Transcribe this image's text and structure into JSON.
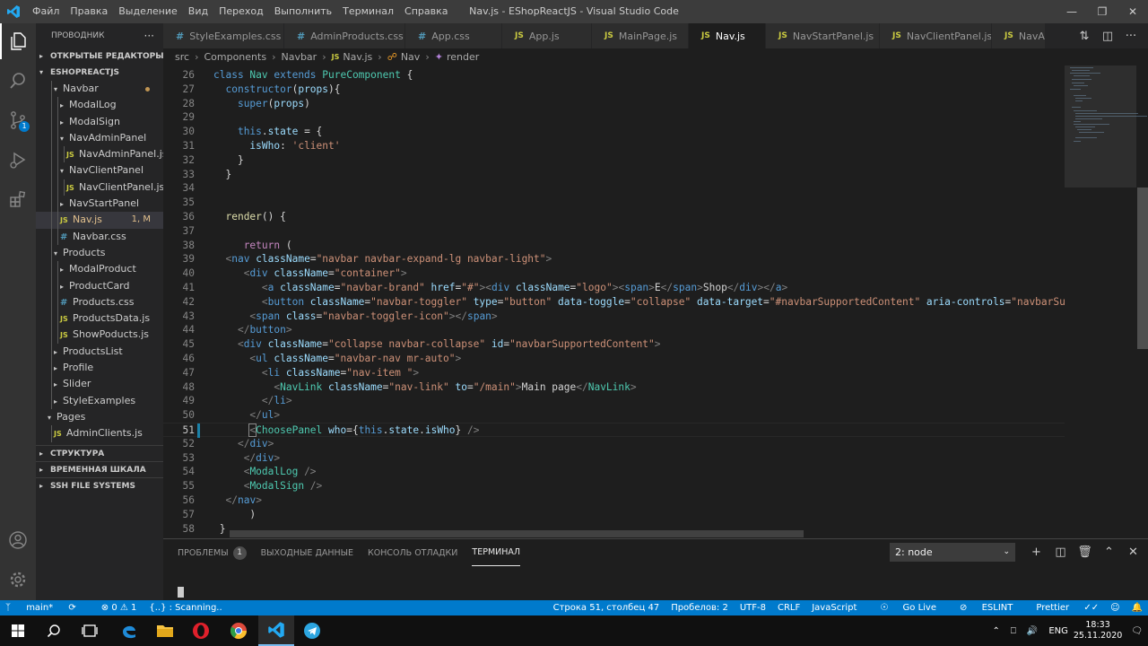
{
  "window": {
    "title": "Nav.js - EShopReactJS - Visual Studio Code",
    "menu": [
      "Файл",
      "Правка",
      "Выделение",
      "Вид",
      "Переход",
      "Выполнить",
      "Терминал",
      "Справка"
    ]
  },
  "activity": {
    "scm_badge": "1"
  },
  "sidebar": {
    "title": "ПРОВОДНИК",
    "more": "···",
    "open_editors": "ОТКРЫТЫЕ РЕДАКТОРЫ",
    "project": "ESHOPREACTJS",
    "tree": [
      {
        "label": "Navbar",
        "kind": "folder-open",
        "depth": 2,
        "modified": true
      },
      {
        "label": "ModalLog",
        "kind": "folder",
        "depth": 3
      },
      {
        "label": "ModalSign",
        "kind": "folder",
        "depth": 3
      },
      {
        "label": "NavAdminPanel",
        "kind": "folder-open",
        "depth": 3
      },
      {
        "label": "NavAdminPanel.js",
        "kind": "js",
        "depth": 4
      },
      {
        "label": "NavClientPanel",
        "kind": "folder-open",
        "depth": 3
      },
      {
        "label": "NavClientPanel.js",
        "kind": "js",
        "depth": 4
      },
      {
        "label": "NavStartPanel",
        "kind": "folder",
        "depth": 3
      },
      {
        "label": "Nav.js",
        "kind": "js",
        "depth": 3,
        "selected": true,
        "badge": "1, M"
      },
      {
        "label": "Navbar.css",
        "kind": "css",
        "depth": 3
      },
      {
        "label": "Products",
        "kind": "folder-open",
        "depth": 2
      },
      {
        "label": "ModalProduct",
        "kind": "folder",
        "depth": 3
      },
      {
        "label": "ProductCard",
        "kind": "folder",
        "depth": 3
      },
      {
        "label": "Products.css",
        "kind": "css",
        "depth": 3
      },
      {
        "label": "ProductsData.js",
        "kind": "js",
        "depth": 3
      },
      {
        "label": "ShowPoducts.js",
        "kind": "js",
        "depth": 3
      },
      {
        "label": "ProductsList",
        "kind": "folder",
        "depth": 2
      },
      {
        "label": "Profile",
        "kind": "folder",
        "depth": 2
      },
      {
        "label": "Slider",
        "kind": "folder",
        "depth": 2
      },
      {
        "label": "StyleExamples",
        "kind": "folder",
        "depth": 2
      },
      {
        "label": "Pages",
        "kind": "folder-open",
        "depth": 1
      },
      {
        "label": "AdminClients.js",
        "kind": "js",
        "depth": 2
      }
    ],
    "sections": [
      "СТРУКТУРА",
      "ВРЕМЕННАЯ ШКАЛА",
      "SSH FILE SYSTEMS"
    ]
  },
  "tabs": [
    {
      "label": "StyleExamples.css",
      "kind": "css"
    },
    {
      "label": "AdminProducts.css",
      "kind": "css"
    },
    {
      "label": "App.css",
      "kind": "css"
    },
    {
      "label": "App.js",
      "kind": "js"
    },
    {
      "label": "MainPage.js",
      "kind": "js"
    },
    {
      "label": "Nav.js",
      "kind": "js",
      "active": true
    },
    {
      "label": "NavStartPanel.js",
      "kind": "js"
    },
    {
      "label": "NavClientPanel.js",
      "kind": "js"
    },
    {
      "label": "NavA",
      "kind": "js"
    }
  ],
  "breadcrumb": [
    "src",
    "Components",
    "Navbar",
    "Nav.js",
    "Nav",
    "render"
  ],
  "editor": {
    "current_line": 51,
    "lines": [
      {
        "n": 26,
        "t": [
          [
            "kw",
            "class "
          ],
          [
            "cls",
            "Nav "
          ],
          [
            "kw",
            "extends "
          ],
          [
            "cls",
            "PureComponent "
          ],
          [
            "txt",
            "{"
          ]
        ]
      },
      {
        "n": 27,
        "t": [
          [
            "txt",
            "  "
          ],
          [
            "kw",
            "constructor"
          ],
          [
            "txt",
            "("
          ],
          [
            "var",
            "props"
          ],
          [
            "txt",
            "){"
          ]
        ]
      },
      {
        "n": 28,
        "t": [
          [
            "txt",
            "    "
          ],
          [
            "kw",
            "super"
          ],
          [
            "txt",
            "("
          ],
          [
            "var",
            "props"
          ],
          [
            "txt",
            ")"
          ]
        ]
      },
      {
        "n": 29,
        "t": []
      },
      {
        "n": 30,
        "t": [
          [
            "txt",
            "    "
          ],
          [
            "kw",
            "this"
          ],
          [
            "txt",
            "."
          ],
          [
            "var",
            "state"
          ],
          [
            "txt",
            " = {"
          ]
        ]
      },
      {
        "n": 31,
        "t": [
          [
            "txt",
            "      "
          ],
          [
            "var",
            "isWho"
          ],
          [
            "txt",
            ": "
          ],
          [
            "str",
            "'client'"
          ]
        ]
      },
      {
        "n": 32,
        "t": [
          [
            "txt",
            "    }"
          ]
        ]
      },
      {
        "n": 33,
        "t": [
          [
            "txt",
            "  }"
          ]
        ]
      },
      {
        "n": 34,
        "t": []
      },
      {
        "n": 35,
        "t": []
      },
      {
        "n": 36,
        "t": [
          [
            "txt",
            "  "
          ],
          [
            "fn",
            "render"
          ],
          [
            "txt",
            "() {"
          ]
        ]
      },
      {
        "n": 37,
        "t": []
      },
      {
        "n": 38,
        "t": [
          [
            "txt",
            "     "
          ],
          [
            "kw2",
            "return"
          ],
          [
            "txt",
            " ("
          ]
        ]
      },
      {
        "n": 39,
        "t": [
          [
            "txt",
            "  "
          ],
          [
            "ang",
            "<"
          ],
          [
            "tag",
            "nav "
          ],
          [
            "attr",
            "className"
          ],
          [
            "txt",
            "="
          ],
          [
            "str",
            "\"navbar navbar-expand-lg navbar-light\""
          ],
          [
            "ang",
            ">"
          ]
        ]
      },
      {
        "n": 40,
        "t": [
          [
            "txt",
            "     "
          ],
          [
            "ang",
            "<"
          ],
          [
            "tag",
            "div "
          ],
          [
            "attr",
            "className"
          ],
          [
            "txt",
            "="
          ],
          [
            "str",
            "\"container\""
          ],
          [
            "ang",
            ">"
          ]
        ]
      },
      {
        "n": 41,
        "t": [
          [
            "txt",
            "        "
          ],
          [
            "ang",
            "<"
          ],
          [
            "tag",
            "a "
          ],
          [
            "attr",
            "className"
          ],
          [
            "txt",
            "="
          ],
          [
            "str",
            "\"navbar-brand\" "
          ],
          [
            "attr",
            "href"
          ],
          [
            "txt",
            "="
          ],
          [
            "str",
            "\"#\""
          ],
          [
            "ang",
            ">"
          ],
          [
            "ang",
            "<"
          ],
          [
            "tag",
            "div "
          ],
          [
            "attr",
            "className"
          ],
          [
            "txt",
            "="
          ],
          [
            "str",
            "\"logo\""
          ],
          [
            "ang",
            ">"
          ],
          [
            "ang",
            "<"
          ],
          [
            "tag",
            "span"
          ],
          [
            "ang",
            ">"
          ],
          [
            "txt",
            "E"
          ],
          [
            "ang",
            "</"
          ],
          [
            "tag",
            "span"
          ],
          [
            "ang",
            ">"
          ],
          [
            "txt",
            "Shop"
          ],
          [
            "ang",
            "</"
          ],
          [
            "tag",
            "div"
          ],
          [
            "ang",
            ">"
          ],
          [
            "ang",
            "</"
          ],
          [
            "tag",
            "a"
          ],
          [
            "ang",
            ">"
          ]
        ]
      },
      {
        "n": 42,
        "t": [
          [
            "txt",
            "        "
          ],
          [
            "ang",
            "<"
          ],
          [
            "tag",
            "button "
          ],
          [
            "attr",
            "className"
          ],
          [
            "txt",
            "="
          ],
          [
            "str",
            "\"navbar-toggler\" "
          ],
          [
            "attr",
            "type"
          ],
          [
            "txt",
            "="
          ],
          [
            "str",
            "\"button\" "
          ],
          [
            "attr",
            "data-toggle"
          ],
          [
            "txt",
            "="
          ],
          [
            "str",
            "\"collapse\" "
          ],
          [
            "attr",
            "data-target"
          ],
          [
            "txt",
            "="
          ],
          [
            "str",
            "\"#navbarSupportedContent\" "
          ],
          [
            "attr",
            "aria-controls"
          ],
          [
            "txt",
            "="
          ],
          [
            "str",
            "\"navbarSupport"
          ]
        ]
      },
      {
        "n": 43,
        "t": [
          [
            "txt",
            "      "
          ],
          [
            "ang",
            "<"
          ],
          [
            "tag",
            "span "
          ],
          [
            "attr",
            "class"
          ],
          [
            "txt",
            "="
          ],
          [
            "str",
            "\"navbar-toggler-icon\""
          ],
          [
            "ang",
            "></"
          ],
          [
            "tag",
            "span"
          ],
          [
            "ang",
            ">"
          ]
        ]
      },
      {
        "n": 44,
        "t": [
          [
            "txt",
            "    "
          ],
          [
            "ang",
            "</"
          ],
          [
            "tag",
            "button"
          ],
          [
            "ang",
            ">"
          ]
        ]
      },
      {
        "n": 45,
        "t": [
          [
            "txt",
            "    "
          ],
          [
            "ang",
            "<"
          ],
          [
            "tag",
            "div "
          ],
          [
            "attr",
            "className"
          ],
          [
            "txt",
            "="
          ],
          [
            "str",
            "\"collapse navbar-collapse\" "
          ],
          [
            "attr",
            "id"
          ],
          [
            "txt",
            "="
          ],
          [
            "str",
            "\"navbarSupportedContent\""
          ],
          [
            "ang",
            ">"
          ]
        ]
      },
      {
        "n": 46,
        "t": [
          [
            "txt",
            "      "
          ],
          [
            "ang",
            "<"
          ],
          [
            "tag",
            "ul "
          ],
          [
            "attr",
            "className"
          ],
          [
            "txt",
            "="
          ],
          [
            "str",
            "\"navbar-nav mr-auto\""
          ],
          [
            "ang",
            ">"
          ]
        ]
      },
      {
        "n": 47,
        "t": [
          [
            "txt",
            "        "
          ],
          [
            "ang",
            "<"
          ],
          [
            "tag",
            "li "
          ],
          [
            "attr",
            "className"
          ],
          [
            "txt",
            "="
          ],
          [
            "str",
            "\"nav-item \""
          ],
          [
            "ang",
            ">"
          ]
        ]
      },
      {
        "n": 48,
        "t": [
          [
            "txt",
            "          "
          ],
          [
            "ang",
            "<"
          ],
          [
            "cmp",
            "NavLink "
          ],
          [
            "attr",
            "className"
          ],
          [
            "txt",
            "="
          ],
          [
            "str",
            "\"nav-link\" "
          ],
          [
            "attr",
            "to"
          ],
          [
            "txt",
            "="
          ],
          [
            "str",
            "\"/main\""
          ],
          [
            "ang",
            ">"
          ],
          [
            "txt",
            "Main page"
          ],
          [
            "ang",
            "</"
          ],
          [
            "cmp",
            "NavLink"
          ],
          [
            "ang",
            ">"
          ]
        ]
      },
      {
        "n": 49,
        "t": [
          [
            "txt",
            "        "
          ],
          [
            "ang",
            "</"
          ],
          [
            "tag",
            "li"
          ],
          [
            "ang",
            ">"
          ]
        ]
      },
      {
        "n": 50,
        "t": [
          [
            "txt",
            "      "
          ],
          [
            "ang",
            "</"
          ],
          [
            "tag",
            "ul"
          ],
          [
            "ang",
            ">"
          ]
        ]
      },
      {
        "n": 51,
        "t": [
          [
            "txt",
            "      "
          ],
          [
            "ang",
            "<"
          ],
          [
            "cmp",
            "ChoosePanel "
          ],
          [
            "attr",
            "who"
          ],
          [
            "txt",
            "={"
          ],
          [
            "kw",
            "this"
          ],
          [
            "txt",
            "."
          ],
          [
            "var",
            "state"
          ],
          [
            "txt",
            "."
          ],
          [
            "var",
            "isWho"
          ],
          [
            "txt",
            "} "
          ],
          [
            "ang",
            "/>"
          ]
        ]
      },
      {
        "n": 52,
        "t": [
          [
            "txt",
            "    "
          ],
          [
            "ang",
            "</"
          ],
          [
            "tag",
            "div"
          ],
          [
            "ang",
            ">"
          ]
        ]
      },
      {
        "n": 53,
        "t": [
          [
            "txt",
            "     "
          ],
          [
            "ang",
            "</"
          ],
          [
            "tag",
            "div"
          ],
          [
            "ang",
            ">"
          ]
        ]
      },
      {
        "n": 54,
        "t": [
          [
            "txt",
            "     "
          ],
          [
            "ang",
            "<"
          ],
          [
            "cmp",
            "ModalLog "
          ],
          [
            "ang",
            "/>"
          ]
        ]
      },
      {
        "n": 55,
        "t": [
          [
            "txt",
            "     "
          ],
          [
            "ang",
            "<"
          ],
          [
            "cmp",
            "ModalSign "
          ],
          [
            "ang",
            "/>"
          ]
        ]
      },
      {
        "n": 56,
        "t": [
          [
            "txt",
            "  "
          ],
          [
            "ang",
            "</"
          ],
          [
            "tag",
            "nav"
          ],
          [
            "ang",
            ">"
          ]
        ]
      },
      {
        "n": 57,
        "t": [
          [
            "txt",
            "      )"
          ]
        ]
      },
      {
        "n": 58,
        "t": [
          [
            "txt",
            " }"
          ]
        ]
      }
    ]
  },
  "panel": {
    "tabs": [
      {
        "label": "ПРОБЛЕМЫ",
        "badge": "1"
      },
      {
        "label": "ВЫХОДНЫЕ ДАННЫЕ"
      },
      {
        "label": "КОНСОЛЬ ОТЛАДКИ"
      },
      {
        "label": "ТЕРМИНАЛ",
        "active": true
      }
    ],
    "terminal_select": "2: node"
  },
  "status": {
    "branch": "main*",
    "errors": "⊗ 0 ⚠ 1",
    "scanning": "{..} : Scanning..",
    "position": "Строка 51, столбец 47",
    "spaces": "Пробелов: 2",
    "encoding": "UTF-8",
    "eol": "CRLF",
    "language": "JavaScript",
    "golive": "Go Live",
    "eslint": "ESLINT",
    "prettier": "Prettier"
  },
  "taskbar": {
    "lang": "ENG",
    "time": "18:33",
    "date": "25.11.2020"
  },
  "colors": {
    "accent": "#007acc",
    "editor_bg": "#1e1e1e",
    "sidebar_bg": "#252526"
  }
}
